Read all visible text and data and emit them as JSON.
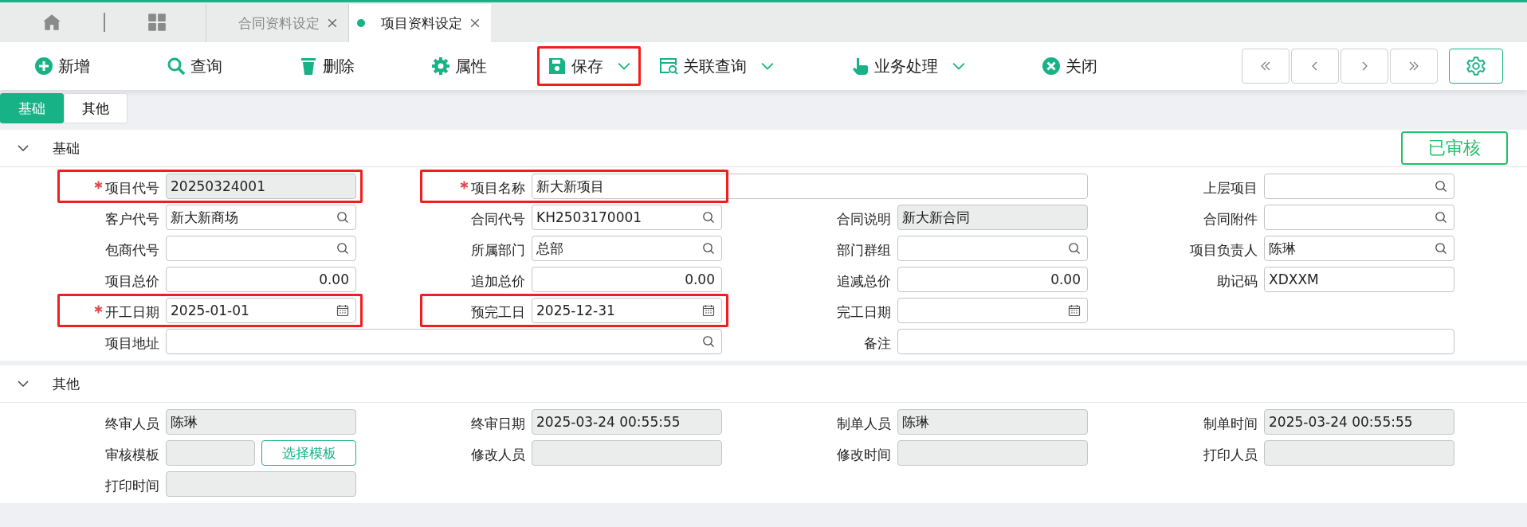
{
  "top_tabs": [
    {
      "label": "合同资料设定",
      "selected": false
    },
    {
      "label": "项目资料设定",
      "selected": true
    }
  ],
  "toolbar": [
    {
      "kind": "add",
      "label": "新增",
      "dropdown": false,
      "highlighted": false
    },
    {
      "kind": "search",
      "label": "查询",
      "dropdown": false,
      "highlighted": false
    },
    {
      "kind": "delete",
      "label": "删除",
      "dropdown": false,
      "highlighted": false
    },
    {
      "kind": "properties",
      "label": "属性",
      "dropdown": false,
      "highlighted": false
    },
    {
      "kind": "save",
      "label": "保存",
      "dropdown": true,
      "highlighted": true
    },
    {
      "kind": "related",
      "label": "关联查询",
      "dropdown": true,
      "highlighted": false
    },
    {
      "kind": "process",
      "label": "业务处理",
      "dropdown": true,
      "highlighted": false
    },
    {
      "kind": "close",
      "label": "关闭",
      "dropdown": false,
      "highlighted": false
    }
  ],
  "form_tabs": [
    {
      "label": "基础",
      "selected": true
    },
    {
      "label": "其他",
      "selected": false
    }
  ],
  "sections": [
    {
      "title": "基础",
      "expanded": true,
      "status": "已审核",
      "rows": [
        [
          {
            "label": "项目代号",
            "kind": "text",
            "readonly": true,
            "required": true,
            "highlighted": true,
            "value": "20250324001"
          },
          {
            "label": "项目名称",
            "kind": "text",
            "readonly": false,
            "required": true,
            "highlighted": true,
            "value": "新大新项目"
          },
          "",
          {
            "label": "上层项目",
            "kind": "lookup",
            "readonly": false,
            "required": false,
            "highlighted": false
          }
        ],
        [
          {
            "label": "客户代号",
            "kind": "lookup",
            "readonly": false,
            "required": false,
            "highlighted": false,
            "value": "新大新商场"
          },
          {
            "label": "合同代号",
            "kind": "lookup",
            "readonly": false,
            "required": false,
            "highlighted": false,
            "value": "KH2503170001"
          },
          {
            "label": "合同说明",
            "kind": "text",
            "readonly": true,
            "required": false,
            "highlighted": false,
            "value": "新大新合同"
          },
          {
            "label": "合同附件",
            "kind": "lookup",
            "readonly": false,
            "required": false,
            "highlighted": false
          }
        ],
        [
          {
            "label": "包商代号",
            "kind": "lookup",
            "readonly": false,
            "required": false,
            "highlighted": false
          },
          {
            "label": "所属部门",
            "kind": "lookup",
            "readonly": false,
            "required": false,
            "highlighted": false,
            "value": "总部"
          },
          {
            "label": "部门群组",
            "kind": "lookup",
            "readonly": false,
            "required": false,
            "highlighted": false
          },
          {
            "label": "项目负责人",
            "kind": "lookup",
            "readonly": false,
            "required": false,
            "highlighted": false,
            "value": "陈琳"
          }
        ],
        [
          {
            "label": "项目总价",
            "kind": "number",
            "readonly": false,
            "required": false,
            "highlighted": false,
            "value": "0.00"
          },
          {
            "label": "追加总价",
            "kind": "number",
            "readonly": false,
            "required": false,
            "highlighted": false,
            "value": "0.00"
          },
          {
            "label": "追减总价",
            "kind": "number",
            "readonly": false,
            "required": false,
            "highlighted": false,
            "value": "0.00"
          },
          {
            "label": "助记码",
            "kind": "text",
            "readonly": false,
            "required": false,
            "highlighted": false,
            "value": "XDXXM"
          }
        ],
        [
          {
            "label": "开工日期",
            "kind": "date",
            "readonly": false,
            "required": true,
            "highlighted": true,
            "value": "2025-01-01"
          },
          {
            "label": "预完工日",
            "kind": "date",
            "readonly": false,
            "required": false,
            "highlighted": true,
            "value": "2025-12-31"
          },
          {
            "label": "完工日期",
            "kind": "date",
            "readonly": false,
            "required": false,
            "highlighted": false
          }
        ],
        [
          {
            "label": "项目地址",
            "kind": "lookup",
            "readonly": false,
            "required": false,
            "highlighted": false
          },
          "",
          {
            "label": "备注",
            "kind": "text",
            "readonly": false,
            "required": false,
            "highlighted": false
          },
          ""
        ]
      ]
    },
    {
      "title": "其他",
      "expanded": true,
      "rows": [
        [
          {
            "label": "终审人员",
            "kind": "text",
            "readonly": true,
            "required": false,
            "highlighted": false,
            "value": "陈琳"
          },
          {
            "label": "终审日期",
            "kind": "text",
            "readonly": true,
            "required": false,
            "highlighted": false,
            "value": "2025-03-24 00:55:55"
          },
          {
            "label": "制单人员",
            "kind": "text",
            "readonly": true,
            "required": false,
            "highlighted": false,
            "value": "陈琳"
          },
          {
            "label": "制单时间",
            "kind": "text",
            "readonly": true,
            "required": false,
            "highlighted": false,
            "value": "2025-03-24 00:55:55"
          }
        ],
        [
          {
            "label": "审核模板",
            "kind": "template",
            "readonly": true,
            "required": false,
            "highlighted": false,
            "button": "选择模板"
          },
          {
            "label": "修改人员",
            "kind": "text",
            "readonly": true,
            "required": false,
            "highlighted": false
          },
          {
            "label": "修改时间",
            "kind": "text",
            "readonly": true,
            "required": false,
            "highlighted": false
          },
          {
            "label": "打印人员",
            "kind": "text",
            "readonly": true,
            "required": false,
            "highlighted": false
          }
        ],
        [
          {
            "label": "打印时间",
            "kind": "text",
            "readonly": true,
            "required": false,
            "highlighted": false
          }
        ]
      ]
    }
  ]
}
